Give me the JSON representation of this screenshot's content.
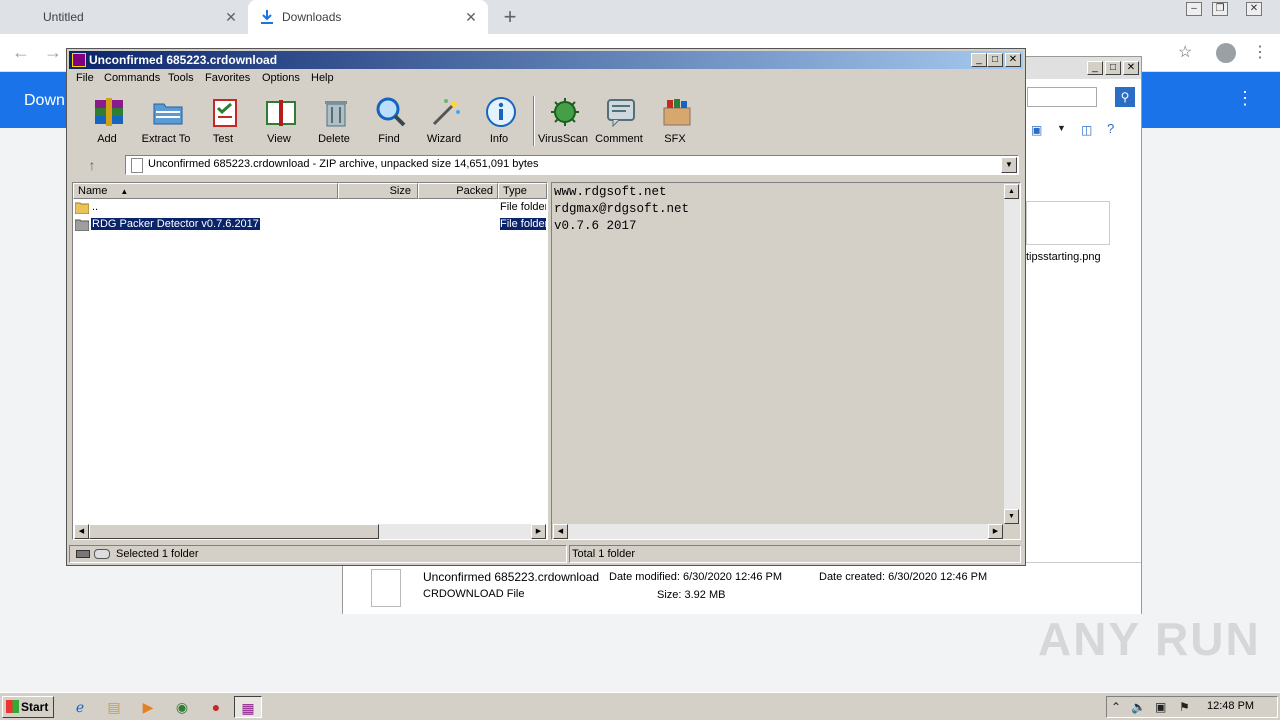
{
  "chrome": {
    "tabs": [
      {
        "label": "Untitled",
        "active": false
      },
      {
        "label": "Downloads",
        "active": true
      }
    ],
    "new_tab": "+",
    "page_header_title": "Down"
  },
  "explorer_bg": {
    "thumbnail_label": "tipsstarting.png",
    "details": {
      "file_name": "Unconfirmed 685223.crdownload",
      "file_type": "CRDOWNLOAD File",
      "date_modified": "Date modified: 6/30/2020 12:46 PM",
      "date_created": "Date created: 6/30/2020 12:46 PM",
      "size": "Size: 3.92 MB"
    }
  },
  "winrar": {
    "title": "Unconfirmed 685223.crdownload",
    "menu": [
      "File",
      "Commands",
      "Tools",
      "Favorites",
      "Options",
      "Help"
    ],
    "toolbar": [
      {
        "label": "Add",
        "icon": "add-archive-icon"
      },
      {
        "label": "Extract To",
        "icon": "extract-icon"
      },
      {
        "label": "Test",
        "icon": "test-icon"
      },
      {
        "label": "View",
        "icon": "view-book-icon"
      },
      {
        "label": "Delete",
        "icon": "trash-icon"
      },
      {
        "label": "Find",
        "icon": "magnifier-icon"
      },
      {
        "label": "Wizard",
        "icon": "wand-icon"
      },
      {
        "label": "Info",
        "icon": "info-icon"
      },
      {
        "label": "VirusScan",
        "icon": "virus-icon"
      },
      {
        "label": "Comment",
        "icon": "comment-icon"
      },
      {
        "label": "SFX",
        "icon": "sfx-box-icon"
      }
    ],
    "address": "Unconfirmed 685223.crdownload - ZIP archive, unpacked size 14,651,091 bytes",
    "columns": {
      "name": "Name",
      "size": "Size",
      "packed": "Packed",
      "type": "Type"
    },
    "rows": [
      {
        "name": "..",
        "type": "File folder",
        "selected": false
      },
      {
        "name": "RDG Packer Detector v0.7.6.2017",
        "type": "File folder",
        "selected": true
      }
    ],
    "comment": [
      "www.rdgsoft.net",
      "rdgmax@rdgsoft.net",
      "v0.7.6 2017"
    ],
    "status_left": "Selected 1 folder",
    "status_right": "Total 1 folder"
  },
  "taskbar": {
    "start": "Start",
    "clock": "12:48 PM"
  },
  "watermark": "ANY RUN",
  "colors": {
    "titlebar": "#0a246a",
    "chrome_blue": "#1a73e8",
    "selection": "#0a246a"
  }
}
